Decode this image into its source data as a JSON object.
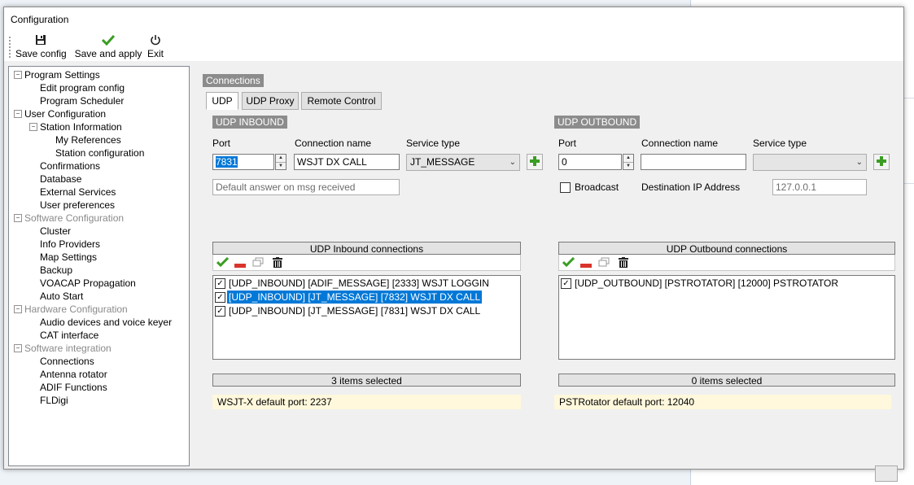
{
  "window": {
    "title": "Configuration"
  },
  "toolbar": {
    "save_config": "Save config",
    "save_apply": "Save and apply",
    "exit": "Exit"
  },
  "tree": [
    {
      "label": "Program Settings",
      "level": 0,
      "expander": true,
      "disabled": false
    },
    {
      "label": "Edit program config",
      "level": 1,
      "expander": false,
      "disabled": false
    },
    {
      "label": "Program Scheduler",
      "level": 1,
      "expander": false,
      "disabled": false
    },
    {
      "label": "User Configuration",
      "level": 0,
      "expander": true,
      "disabled": false
    },
    {
      "label": "Station Information",
      "level": 1,
      "expander": true,
      "disabled": false
    },
    {
      "label": "My References",
      "level": 2,
      "expander": false,
      "disabled": false
    },
    {
      "label": "Station configuration",
      "level": 2,
      "expander": false,
      "disabled": false
    },
    {
      "label": "Confirmations",
      "level": 1,
      "expander": false,
      "disabled": false
    },
    {
      "label": "Database",
      "level": 1,
      "expander": false,
      "disabled": false
    },
    {
      "label": "External Services",
      "level": 1,
      "expander": false,
      "disabled": false
    },
    {
      "label": "User preferences",
      "level": 1,
      "expander": false,
      "disabled": false
    },
    {
      "label": "Software Configuration",
      "level": 0,
      "expander": true,
      "disabled": true
    },
    {
      "label": "Cluster",
      "level": 1,
      "expander": false,
      "disabled": false
    },
    {
      "label": "Info Providers",
      "level": 1,
      "expander": false,
      "disabled": false
    },
    {
      "label": "Map Settings",
      "level": 1,
      "expander": false,
      "disabled": false
    },
    {
      "label": "Backup",
      "level": 1,
      "expander": false,
      "disabled": false
    },
    {
      "label": "VOACAP Propagation",
      "level": 1,
      "expander": false,
      "disabled": false
    },
    {
      "label": "Auto Start",
      "level": 1,
      "expander": false,
      "disabled": false
    },
    {
      "label": "Hardware Configuration",
      "level": 0,
      "expander": true,
      "disabled": true
    },
    {
      "label": "Audio devices and voice keyer",
      "level": 1,
      "expander": false,
      "disabled": false
    },
    {
      "label": "CAT interface",
      "level": 1,
      "expander": false,
      "disabled": false
    },
    {
      "label": "Software integration",
      "level": 0,
      "expander": true,
      "disabled": true
    },
    {
      "label": "Connections",
      "level": 1,
      "expander": false,
      "disabled": false
    },
    {
      "label": "Antenna rotator",
      "level": 1,
      "expander": false,
      "disabled": false
    },
    {
      "label": "ADIF Functions",
      "level": 1,
      "expander": false,
      "disabled": false
    },
    {
      "label": "FLDigi",
      "level": 1,
      "expander": false,
      "disabled": false
    }
  ],
  "connections": {
    "group_label": "Connections",
    "tabs": [
      "UDP",
      "UDP Proxy",
      "Remote Control"
    ],
    "inbound": {
      "header": "UDP INBOUND",
      "port_label": "Port",
      "port_value": "7831",
      "name_label": "Connection name",
      "name_value": "WSJT DX CALL",
      "service_label": "Service type",
      "service_value": "JT_MESSAGE",
      "default_answer_placeholder": "Default answer on msg received",
      "list_header": "UDP Inbound connections",
      "items": [
        {
          "text": "[UDP_INBOUND] [ADIF_MESSAGE] [2333] WSJT LOGGIN",
          "checked": true,
          "highlight": false
        },
        {
          "text": "[UDP_INBOUND] [JT_MESSAGE] [7832] WSJT DX CALL",
          "checked": true,
          "highlight": true
        },
        {
          "text": "[UDP_INBOUND] [JT_MESSAGE] [7831] WSJT DX CALL",
          "checked": true,
          "highlight": false
        }
      ],
      "status": "3 items selected",
      "note": "WSJT-X default port: 2237"
    },
    "outbound": {
      "header": "UDP OUTBOUND",
      "port_label": "Port",
      "port_value": "0",
      "name_label": "Connection name",
      "name_value": "",
      "service_label": "Service type",
      "service_value": "",
      "broadcast_label": "Broadcast",
      "broadcast_checked": false,
      "dest_ip_label": "Destination IP Address",
      "dest_ip_value": "127.0.0.1",
      "list_header": "UDP Outbound connections",
      "items": [
        {
          "text": "[UDP_OUTBOUND] [PSTROTATOR] [12000] PSTROTATOR",
          "checked": true,
          "highlight": false
        }
      ],
      "status": "0 items selected",
      "note": "PSTRotator default port: 12040"
    }
  },
  "colors": {
    "selection": "#0078d7",
    "check_green": "#3a9d23",
    "remove_red": "#d9342b",
    "note_bg": "#fff8dc"
  }
}
